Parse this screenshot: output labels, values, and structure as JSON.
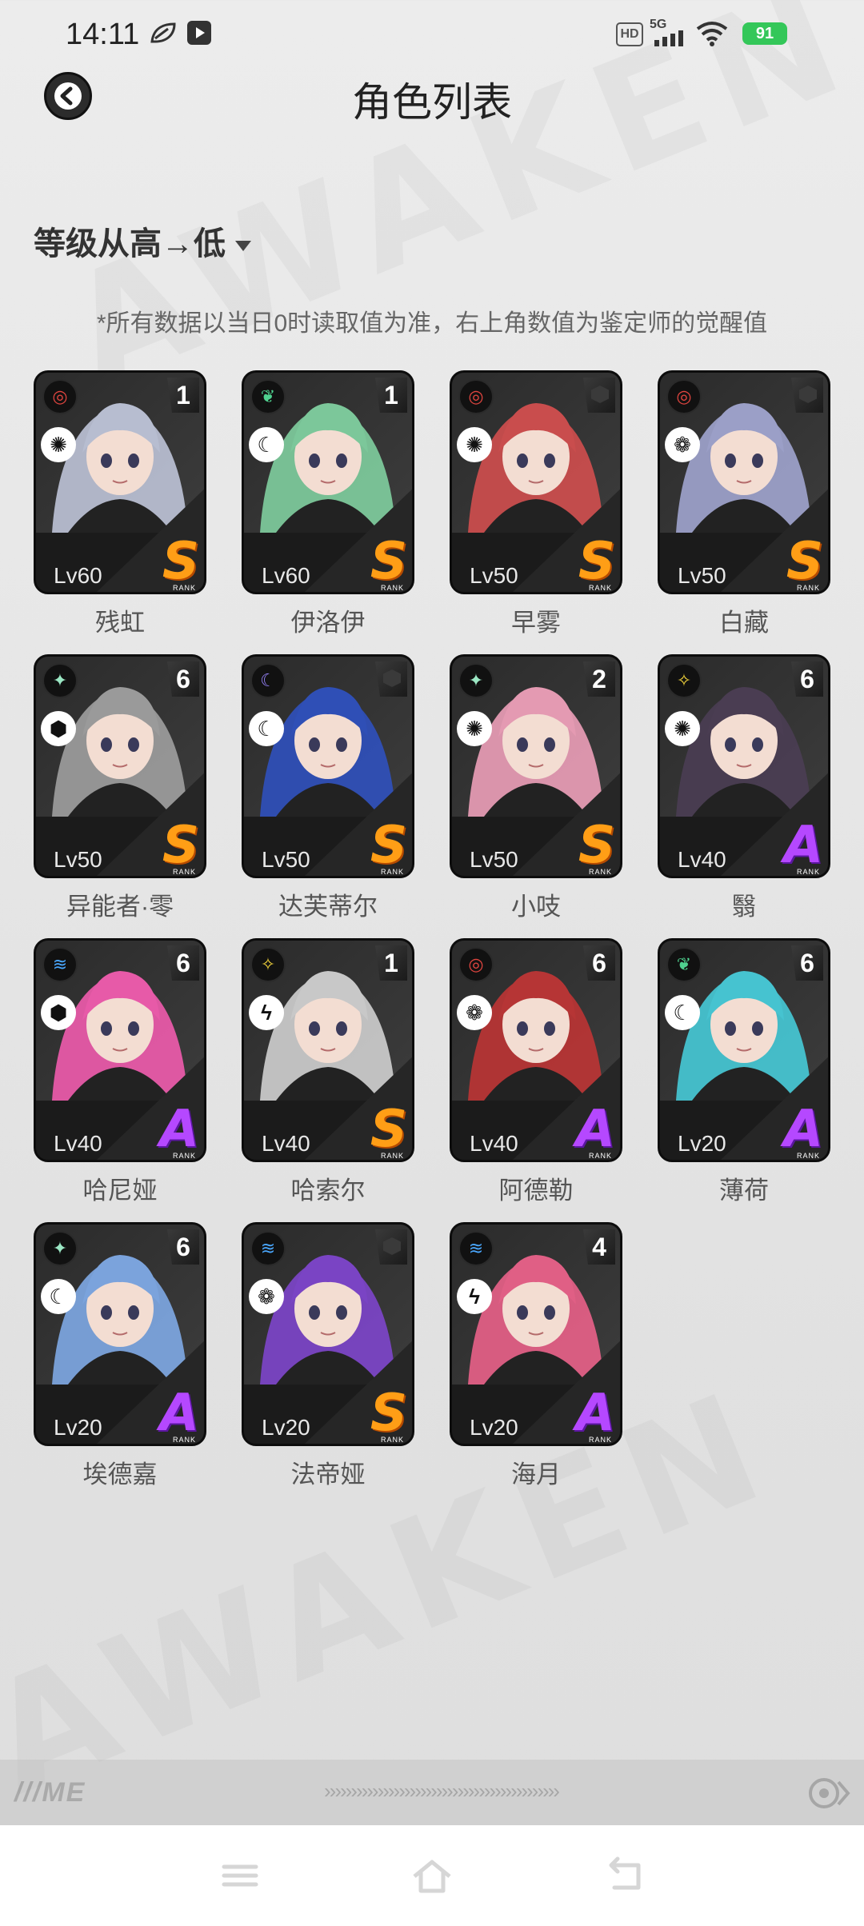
{
  "status_bar": {
    "time": "14:11",
    "battery": "91",
    "network": "5G",
    "hd_badge": "HD"
  },
  "header": {
    "title": "角色列表"
  },
  "sort": {
    "label": "等级从高→低"
  },
  "note": "*所有数据以当日0时读取值为准，右上角数值为鉴定师的觉醒值",
  "rank_caption": "RANK",
  "characters": [
    {
      "name": "残虹",
      "level": "Lv60",
      "rank": "S",
      "awakening": "1",
      "attribute_icon": "crosshair-red-icon",
      "role_icon": "swirl-icon",
      "color": "#b7bdd0"
    },
    {
      "name": "伊洛伊",
      "level": "Lv60",
      "rank": "S",
      "awakening": "1",
      "attribute_icon": "leaf-green-icon",
      "role_icon": "crescent-icon",
      "color": "#7cc79a"
    },
    {
      "name": "早雾",
      "level": "Lv50",
      "rank": "S",
      "awakening": "",
      "attribute_icon": "crosshair-red-icon",
      "role_icon": "swirl-icon",
      "color": "#c94d4d"
    },
    {
      "name": "白藏",
      "level": "Lv50",
      "rank": "S",
      "awakening": "",
      "attribute_icon": "crosshair-red-icon",
      "role_icon": "gear-flower-icon",
      "color": "#9b9fc7"
    },
    {
      "name": "异能者·零",
      "level": "Lv50",
      "rank": "S",
      "awakening": "6",
      "attribute_icon": "star-green-icon",
      "role_icon": "cube-icon",
      "color": "#9a9a9a"
    },
    {
      "name": "达芙蒂尔",
      "level": "Lv50",
      "rank": "S",
      "awakening": "",
      "attribute_icon": "moon-purple-icon",
      "role_icon": "crescent-icon",
      "color": "#2f4fb6"
    },
    {
      "name": "小吱",
      "level": "Lv50",
      "rank": "S",
      "awakening": "2",
      "attribute_icon": "star-green-icon",
      "role_icon": "swirl-icon",
      "color": "#e49ab2"
    },
    {
      "name": "翳",
      "level": "Lv40",
      "rank": "A",
      "awakening": "6",
      "attribute_icon": "spark-yellow-icon",
      "role_icon": "swirl-icon",
      "color": "#4a3d52"
    },
    {
      "name": "哈尼娅",
      "level": "Lv40",
      "rank": "A",
      "awakening": "6",
      "attribute_icon": "water-blue-icon",
      "role_icon": "cube-icon",
      "color": "#e75aa8"
    },
    {
      "name": "哈索尔",
      "level": "Lv40",
      "rank": "S",
      "awakening": "1",
      "attribute_icon": "spark-yellow-icon",
      "role_icon": "bolt-icon",
      "color": "#c8c8c8"
    },
    {
      "name": "阿德勒",
      "level": "Lv40",
      "rank": "A",
      "awakening": "6",
      "attribute_icon": "crosshair-red-icon",
      "role_icon": "gear-flower-icon",
      "color": "#b63535"
    },
    {
      "name": "薄荷",
      "level": "Lv20",
      "rank": "A",
      "awakening": "6",
      "attribute_icon": "leaf-green-icon",
      "role_icon": "crescent-icon",
      "color": "#46c3d0"
    },
    {
      "name": "埃德嘉",
      "level": "Lv20",
      "rank": "A",
      "awakening": "6",
      "attribute_icon": "star-green-icon",
      "role_icon": "crescent-icon",
      "color": "#7ba3dc"
    },
    {
      "name": "法帝娅",
      "level": "Lv20",
      "rank": "S",
      "awakening": "",
      "attribute_icon": "water-blue-icon",
      "role_icon": "gear-flower-icon",
      "color": "#7a44c4"
    },
    {
      "name": "海月",
      "level": "Lv20",
      "rank": "A",
      "awakening": "4",
      "attribute_icon": "water-blue-icon",
      "role_icon": "bolt-icon",
      "color": "#e05f85"
    }
  ]
}
